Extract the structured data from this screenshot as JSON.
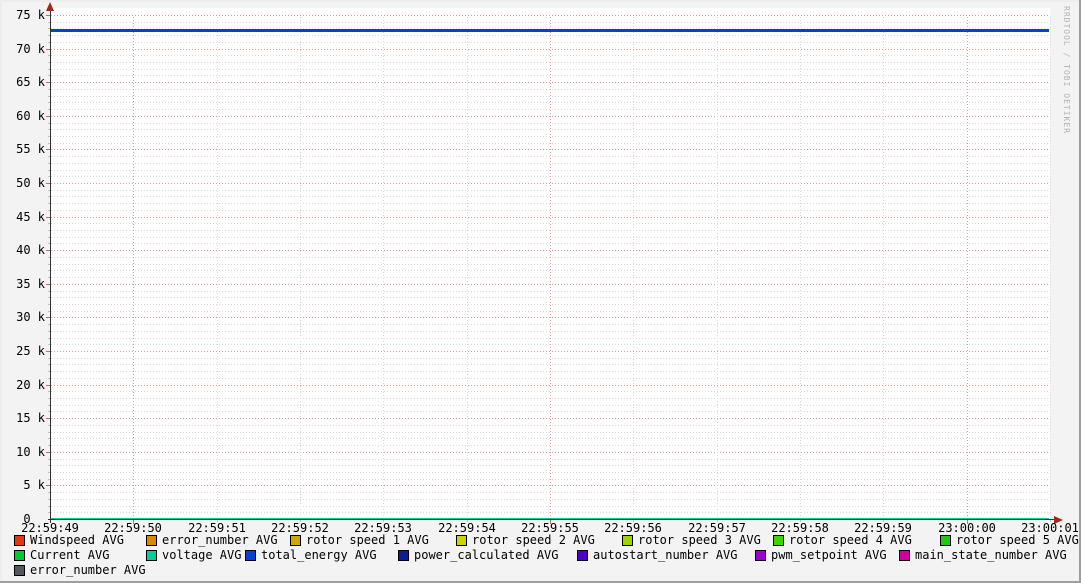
{
  "watermark": "RRDTOOL / TOBI OETIKER",
  "chart_data": {
    "type": "line",
    "title": "",
    "x_axis": {
      "labels": [
        "22:59:49",
        "22:59:50",
        "22:59:51",
        "22:59:52",
        "22:59:53",
        "22:59:54",
        "22:59:55",
        "22:59:56",
        "22:59:57",
        "22:59:58",
        "22:59:59",
        "23:00:00",
        "23:00:01"
      ],
      "major_gridline_labels": [
        "22:59:50",
        "22:59:55",
        "23:00:00"
      ],
      "start": "22:59:49",
      "end": "23:00:01",
      "seconds_span": 12
    },
    "y_axis": {
      "labels": [
        "75 k",
        "70 k",
        "65 k",
        "60 k",
        "55 k",
        "50 k",
        "45 k",
        "40 k",
        "35 k",
        "30 k",
        "25 k",
        "20 k",
        "15 k",
        "10 k",
        "5 k",
        "0  "
      ],
      "label_values": [
        75000,
        70000,
        65000,
        60000,
        55000,
        50000,
        45000,
        40000,
        35000,
        30000,
        25000,
        20000,
        15000,
        10000,
        5000,
        0
      ],
      "min": 0,
      "max": 75000,
      "major_step": 5000,
      "minor_step": 1000,
      "unit": "k"
    },
    "series": [
      {
        "name": "Windspeed",
        "legend": "Windspeed AVG",
        "color": "#E3380E",
        "value": null
      },
      {
        "name": "error_number",
        "legend": "error_number AVG",
        "color": "#DB8A00",
        "value": null
      },
      {
        "name": "rotor speed 1",
        "legend": "rotor speed 1 AVG",
        "color": "#D0A900",
        "value": null
      },
      {
        "name": "rotor speed 2",
        "legend": "rotor speed 2 AVG",
        "color": "#C9D400",
        "value": null
      },
      {
        "name": "rotor speed 3",
        "legend": "rotor speed 3 AVG",
        "color": "#9ED400",
        "value": null
      },
      {
        "name": "rotor speed 4",
        "legend": "rotor speed 4 AVG",
        "color": "#3FD400",
        "value": null
      },
      {
        "name": "rotor speed 5",
        "legend": "rotor speed 5 AVG",
        "color": "#1FCB12",
        "value": null
      },
      {
        "name": "Current",
        "legend": "Current AVG",
        "color": "#00CC30",
        "value": 0
      },
      {
        "name": "voltage",
        "legend": "voltage AVG",
        "color": "#00CE9C",
        "value": 0
      },
      {
        "name": "total_energy",
        "legend": "total_energy AVG",
        "color": "#0A3FD4",
        "value": 72800
      },
      {
        "name": "power_calculated",
        "legend": "power_calculated AVG",
        "color": "#0A1E96",
        "value": null
      },
      {
        "name": "autostart_number",
        "legend": "autostart_number AVG",
        "color": "#4A00CD",
        "value": null
      },
      {
        "name": "pwm_setpoint",
        "legend": "pwm_setpoint AVG",
        "color": "#9E00CD",
        "value": null
      },
      {
        "name": "main_state_number",
        "legend": "main_state_number AVG",
        "color": "#CD009E",
        "value": null
      },
      {
        "name": "error_number_2",
        "legend": "error_number AVG",
        "color": "#55585A",
        "value": null
      }
    ],
    "grid": {
      "on": true,
      "major_color": "#E39A9A",
      "minor_color": "#D9D9D9"
    },
    "legend_position": "bottom",
    "canvas_color": "#FFFFFF",
    "background_color": "#F3F3F3",
    "axis_color": "#333333",
    "arrow_color": "#A0281E"
  },
  "legend": {
    "rows": [
      [
        0,
        1,
        2,
        3,
        4,
        5,
        6
      ],
      [
        7,
        8,
        9,
        10,
        11,
        12,
        13
      ],
      [
        14
      ]
    ]
  }
}
